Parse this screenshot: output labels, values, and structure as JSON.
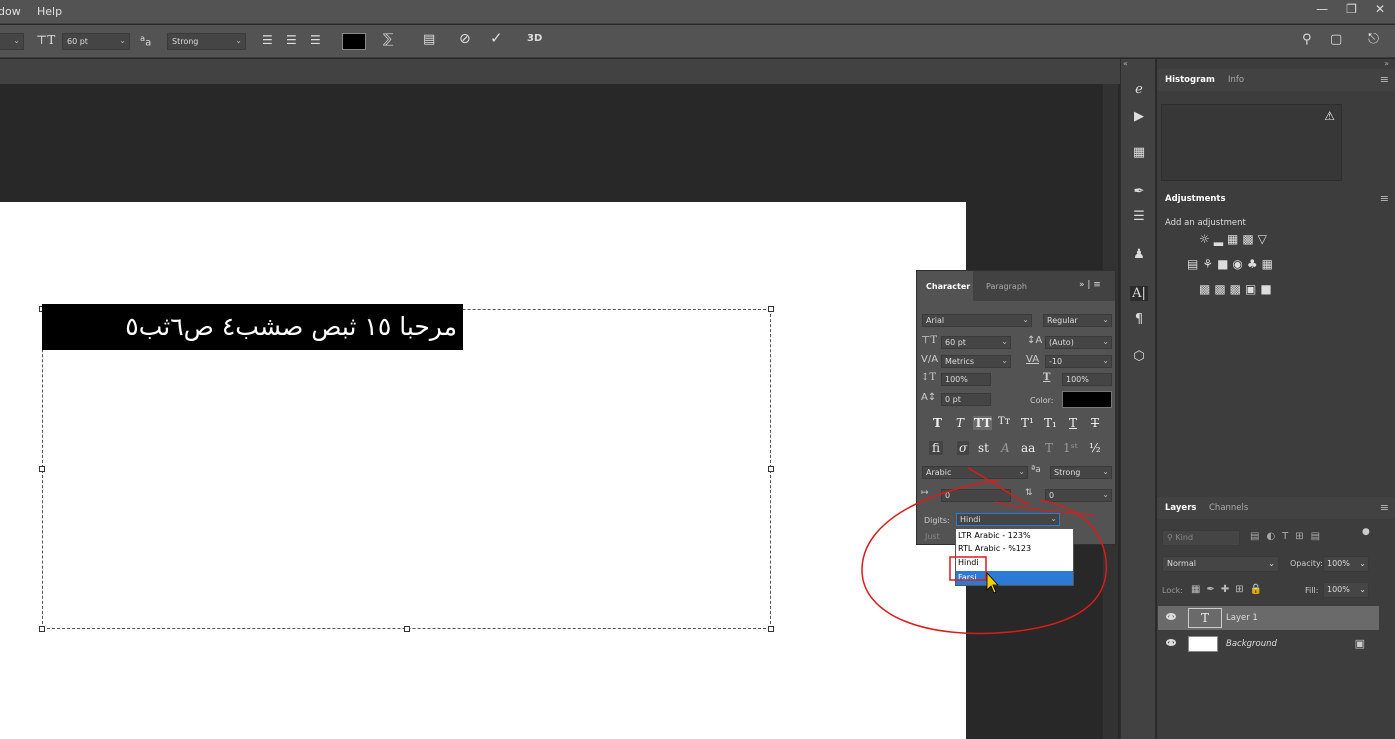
{
  "menubar": {
    "items": [
      "dow",
      "Help"
    ]
  },
  "window_controls": [
    "minimize-icon",
    "restore-icon",
    "close-icon"
  ],
  "options_bar": {
    "font_size": "60 pt",
    "antialias_icon": "a",
    "antialias_superscript": "a",
    "antialias": "Strong",
    "threed_label": "3D"
  },
  "canvas": {
    "text_content": "مرحبا ١٥ ثبص صشب٤ ص٦ثب٥"
  },
  "character_panel": {
    "tab_character": "Character",
    "tab_paragraph": "Paragraph",
    "font_family": "Arial",
    "font_style": "Regular",
    "font_size": "60 pt",
    "leading": "(Auto)",
    "kerning": "Metrics",
    "tracking": "-10",
    "vertical_scale": "100%",
    "horizontal_scale": "100%",
    "baseline_shift": "0 pt",
    "color_label": "Color:",
    "color_value": "#000000",
    "language": "Arabic",
    "antialias": "Strong",
    "field_a": "0",
    "field_b": "0",
    "digits_label": "Digits:",
    "digits_value": "Hindi",
    "just_label": "Just"
  },
  "digits_dropdown": {
    "options": [
      "LTR Arabic - 123%",
      "RTL Arabic - %123",
      "Hindi",
      "Farsi"
    ],
    "highlighted": "Farsi"
  },
  "histogram_panel": {
    "tabs": [
      "Histogram",
      "Info"
    ],
    "warning_icon": "warning-icon"
  },
  "adjustments_panel": {
    "title": "Adjustments",
    "hint": "Add an adjustment"
  },
  "layers_panel": {
    "tabs": [
      "Layers",
      "Channels"
    ],
    "search_placeholder": "Kind",
    "blend_mode": "Normal",
    "opacity_label": "Opacity:",
    "opacity_value": "100%",
    "lock_label": "Lock:",
    "fill_label": "Fill:",
    "fill_value": "100%",
    "layers": [
      {
        "name": "Layer 1",
        "type": "text"
      },
      {
        "name": "Background",
        "type": "background"
      }
    ]
  },
  "colors": {
    "annotation_red": "#d91c1c",
    "highlight_blue": "#2b7bd6"
  }
}
